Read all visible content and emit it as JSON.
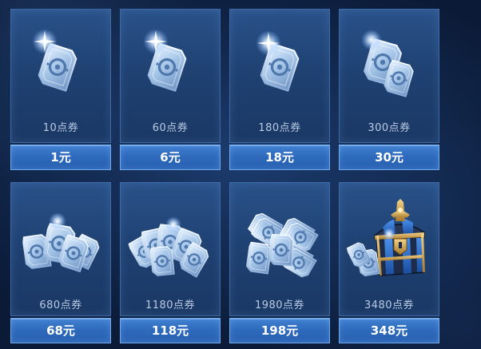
{
  "items": [
    {
      "amount": "10点券",
      "price": "1元",
      "icon": "single-voucher-card-icon"
    },
    {
      "amount": "60点券",
      "price": "6元",
      "icon": "single-voucher-card-icon"
    },
    {
      "amount": "180点券",
      "price": "18元",
      "icon": "single-voucher-card-icon"
    },
    {
      "amount": "300点券",
      "price": "30元",
      "icon": "double-voucher-cards-icon"
    },
    {
      "amount": "680点券",
      "price": "68元",
      "icon": "voucher-card-fan-icon"
    },
    {
      "amount": "1180点券",
      "price": "118元",
      "icon": "voucher-card-large-fan-icon"
    },
    {
      "amount": "1980点券",
      "price": "198元",
      "icon": "voucher-card-stacks-icon"
    },
    {
      "amount": "3480点券",
      "price": "348元",
      "icon": "treasure-chest-icon"
    }
  ],
  "colors": {
    "panel": "#1f4273",
    "panel_border": "#3d6aa6",
    "button": "#2e69bb",
    "button_border": "#6fa9ec",
    "label_text": "#b9cbe4",
    "chest_gold": "#d6a84a",
    "chest_blue": "#2a6fd1"
  }
}
